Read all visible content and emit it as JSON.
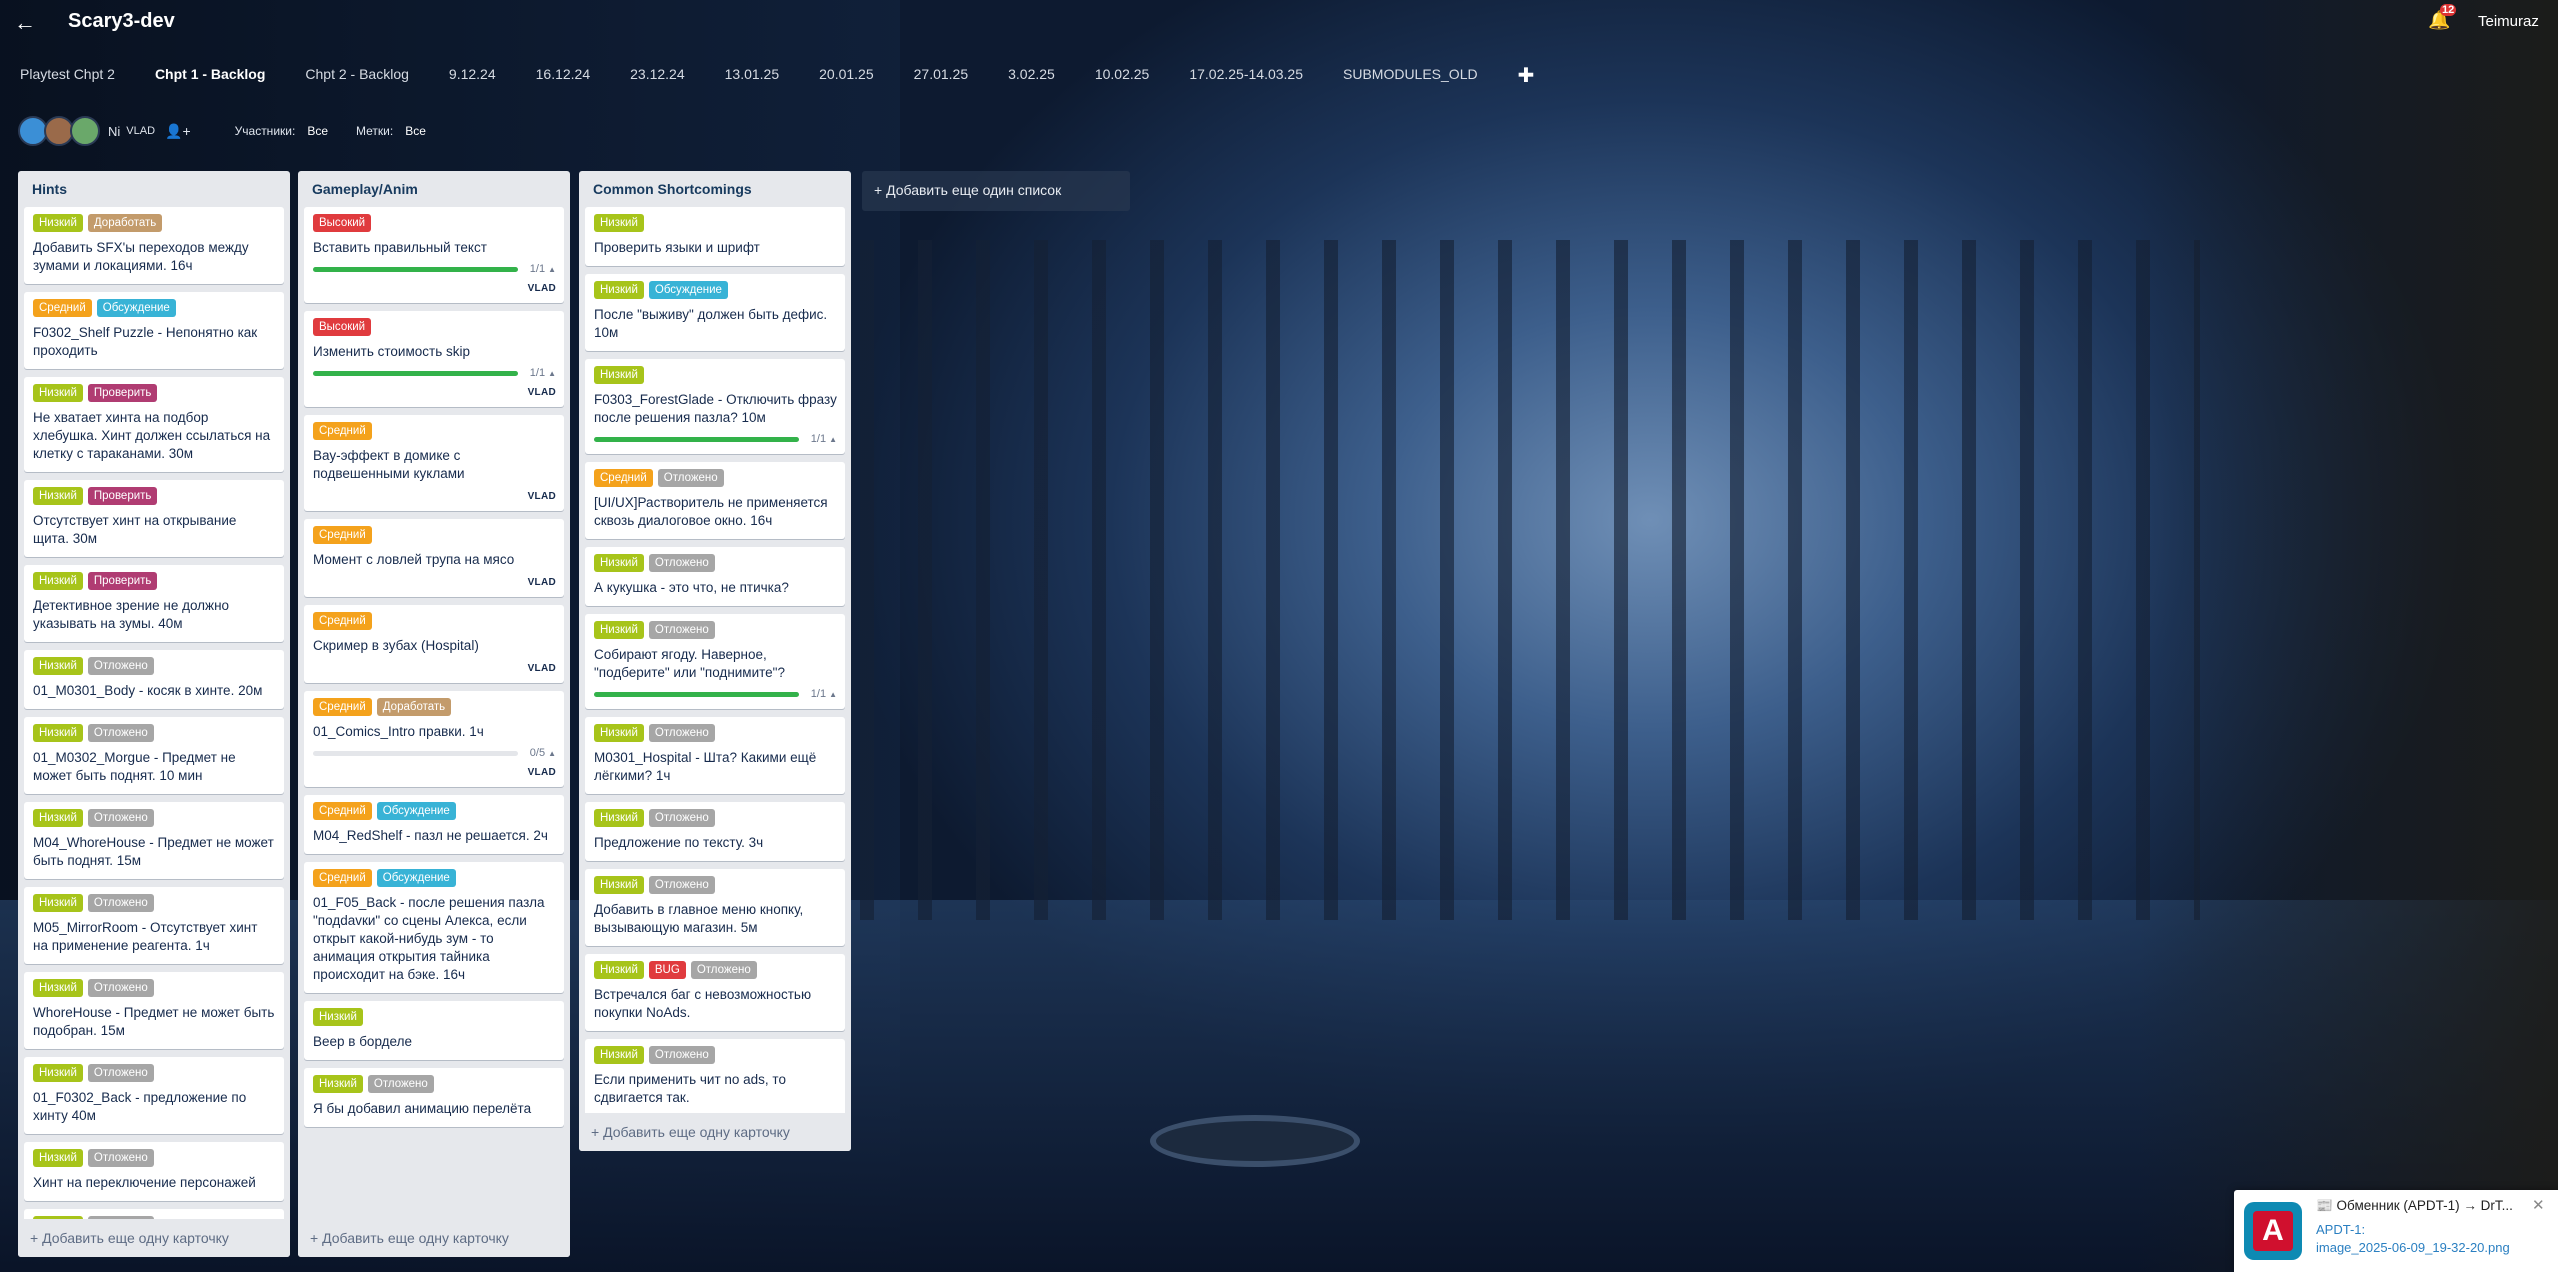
{
  "header": {
    "back_icon": "←",
    "title": "Scary3-dev",
    "bell_icon": "🔔",
    "notification_count": "12",
    "username": "Teimuraz"
  },
  "tabs": [
    {
      "label": "Playtest Chpt 2",
      "active": false
    },
    {
      "label": "Chpt 1 - Backlog",
      "active": true
    },
    {
      "label": "Chpt 2 - Backlog",
      "active": false
    },
    {
      "label": "9.12.24",
      "active": false
    },
    {
      "label": "16.12.24",
      "active": false
    },
    {
      "label": "23.12.24",
      "active": false
    },
    {
      "label": "13.01.25",
      "active": false
    },
    {
      "label": "20.01.25",
      "active": false
    },
    {
      "label": "27.01.25",
      "active": false
    },
    {
      "label": "3.02.25",
      "active": false
    },
    {
      "label": "10.02.25",
      "active": false
    },
    {
      "label": "17.02.25-14.03.25",
      "active": false
    },
    {
      "label": "SUBMODULES_OLD",
      "active": false
    }
  ],
  "tab_add": "✚",
  "members": {
    "avatar_colors": [
      "#3b8fd6",
      "#9a6a4a",
      "#6aa86a"
    ],
    "initials": "Ni",
    "vlad": "VLAD",
    "add_icon": "👤+",
    "participants_label": "Участники:",
    "participants_value": "Все",
    "tags_label": "Метки:",
    "tags_value": "Все"
  },
  "label_colors": {
    "low": "#a7c41a",
    "mid": "#f4a21c",
    "high": "#e03b3e",
    "rework": "#c39b6b",
    "discuss": "#38b3d6",
    "check": "#b03c72",
    "postponed": "#a6a6a6",
    "bug": "#e03b3e"
  },
  "lists": [
    {
      "title": "Hints",
      "footer": "+ Добавить еще одну карточку",
      "cards": [
        {
          "labels": [
            [
              "Низкий",
              "low"
            ],
            [
              "Доработать",
              "rework"
            ]
          ],
          "text": "Добавить SFX'ы переходов между зумами и локациями. 16ч"
        },
        {
          "labels": [
            [
              "Средний",
              "mid"
            ],
            [
              "Обсуждение",
              "discuss"
            ]
          ],
          "text": "F0302_Shelf Puzzle - Непонятно как проходить"
        },
        {
          "labels": [
            [
              "Низкий",
              "low"
            ],
            [
              "Проверить",
              "check"
            ]
          ],
          "text": "Не хватает хинта на подбор хлебушка. Хинт должен ссылаться на клетку с тараканами. 30м"
        },
        {
          "labels": [
            [
              "Низкий",
              "low"
            ],
            [
              "Проверить",
              "check"
            ]
          ],
          "text": "Отсутствует хинт на открывание щита. 30м"
        },
        {
          "labels": [
            [
              "Низкий",
              "low"
            ],
            [
              "Проверить",
              "check"
            ]
          ],
          "text": "Детективное зрение не должно указывать на зумы. 40м"
        },
        {
          "labels": [
            [
              "Низкий",
              "low"
            ],
            [
              "Отложено",
              "postponed"
            ]
          ],
          "text": "01_M0301_Body - косяк в хинте. 20м"
        },
        {
          "labels": [
            [
              "Низкий",
              "low"
            ],
            [
              "Отложено",
              "postponed"
            ]
          ],
          "text": "01_M0302_Morgue - Предмет не может быть поднят. 10 мин"
        },
        {
          "labels": [
            [
              "Низкий",
              "low"
            ],
            [
              "Отложено",
              "postponed"
            ]
          ],
          "text": "M04_WhoreHouse - Предмет не может быть поднят. 15м"
        },
        {
          "labels": [
            [
              "Низкий",
              "low"
            ],
            [
              "Отложено",
              "postponed"
            ]
          ],
          "text": "M05_MirrorRoom - Отсутствует хинт на применение реагента. 1ч"
        },
        {
          "labels": [
            [
              "Низкий",
              "low"
            ],
            [
              "Отложено",
              "postponed"
            ]
          ],
          "text": "WhoreHouse - Предмет не может быть подобран. 15м"
        },
        {
          "labels": [
            [
              "Низкий",
              "low"
            ],
            [
              "Отложено",
              "postponed"
            ]
          ],
          "text": "01_F0302_Back - предложение по хинту 40м"
        },
        {
          "labels": [
            [
              "Низкий",
              "low"
            ],
            [
              "Отложено",
              "postponed"
            ]
          ],
          "text": "Хинт на переключение персонажей"
        },
        {
          "labels": [
            [
              "Низкий",
              "low"
            ],
            [
              "Отложено",
              "postponed"
            ]
          ],
          "text": ""
        }
      ]
    },
    {
      "title": "Gameplay/Anim",
      "footer": "+ Добавить еще одну карточку",
      "cards": [
        {
          "labels": [
            [
              "Высокий",
              "high"
            ]
          ],
          "text": "Вставить правильный текст",
          "progress": {
            "text": "1/1",
            "fraction": 1
          },
          "member": "VLAD"
        },
        {
          "labels": [
            [
              "Высокий",
              "high"
            ]
          ],
          "text": "Изменить стоимость skip",
          "progress": {
            "text": "1/1",
            "fraction": 1
          },
          "member": "VLAD"
        },
        {
          "labels": [
            [
              "Средний",
              "mid"
            ]
          ],
          "text": "Вау-эффект в домике с подвешенными куклами",
          "member": "VLAD"
        },
        {
          "labels": [
            [
              "Средний",
              "mid"
            ]
          ],
          "text": "Момент с ловлей трупа на мясо",
          "member": "VLAD"
        },
        {
          "labels": [
            [
              "Средний",
              "mid"
            ]
          ],
          "text": "Скример в зубах (Hospital)",
          "member": "VLAD"
        },
        {
          "labels": [
            [
              "Средний",
              "mid"
            ],
            [
              "Доработать",
              "rework"
            ]
          ],
          "text": "01_Comics_Intro правки. 1ч",
          "progress": {
            "text": "0/5",
            "fraction": 0
          },
          "member": "VLAD"
        },
        {
          "labels": [
            [
              "Средний",
              "mid"
            ],
            [
              "Обсуждение",
              "discuss"
            ]
          ],
          "text": "M04_RedShelf - пазл не решается. 2ч"
        },
        {
          "labels": [
            [
              "Средний",
              "mid"
            ],
            [
              "Обсуждение",
              "discuss"
            ]
          ],
          "text": "01_F05_Back - после решения пазла \"подdavки\" со сцены Алекса, если открыт какой-нибудь зум - то анимация открытия тайника происходит на бэке. 16ч"
        },
        {
          "labels": [
            [
              "Низкий",
              "low"
            ]
          ],
          "text": "Веер в борделе"
        },
        {
          "labels": [
            [
              "Низкий",
              "low"
            ],
            [
              "Отложено",
              "postponed"
            ]
          ],
          "text": "Я бы добавил анимацию перелёта"
        }
      ]
    },
    {
      "title": "Common Shortcomings",
      "footer": "+ Добавить еще одну карточку",
      "cards": [
        {
          "labels": [
            [
              "Низкий",
              "low"
            ]
          ],
          "text": "Проверить языки и шрифт"
        },
        {
          "labels": [
            [
              "Низкий",
              "low"
            ],
            [
              "Обсуждение",
              "discuss"
            ]
          ],
          "text": "После \"выживу\" должен быть дефис. 10м"
        },
        {
          "labels": [
            [
              "Низкий",
              "low"
            ]
          ],
          "text": "F0303_ForestGlade - Отключить фразу после решения пазла? 10м",
          "progress": {
            "text": "1/1",
            "fraction": 1
          }
        },
        {
          "labels": [
            [
              "Средний",
              "mid"
            ],
            [
              "Отложено",
              "postponed"
            ]
          ],
          "text": "[UI/UX]Растворитель не применяется сквозь диалоговое окно. 16ч"
        },
        {
          "labels": [
            [
              "Низкий",
              "low"
            ],
            [
              "Отложено",
              "postponed"
            ]
          ],
          "text": "А кукушка - это что, не птичка?"
        },
        {
          "labels": [
            [
              "Низкий",
              "low"
            ],
            [
              "Отложено",
              "postponed"
            ]
          ],
          "text": "Собирают ягоду. Наверное, \"подберите\" или \"поднимите\"?",
          "progress": {
            "text": "1/1",
            "fraction": 1
          }
        },
        {
          "labels": [
            [
              "Низкий",
              "low"
            ],
            [
              "Отложено",
              "postponed"
            ]
          ],
          "text": "M0301_Hospital - Шта? Какими ещё лёгкими? 1ч"
        },
        {
          "labels": [
            [
              "Низкий",
              "low"
            ],
            [
              "Отложено",
              "postponed"
            ]
          ],
          "text": "Предложение по тексту. 3ч"
        },
        {
          "labels": [
            [
              "Низкий",
              "low"
            ],
            [
              "Отложено",
              "postponed"
            ]
          ],
          "text": "Добавить в главное меню кнопку, вызывающую магазин. 5м"
        },
        {
          "labels": [
            [
              "Низкий",
              "low"
            ],
            [
              "BUG",
              "bug"
            ],
            [
              "Отложено",
              "postponed"
            ]
          ],
          "text": "Встречался баг с невозможностью покупки NoAds."
        },
        {
          "labels": [
            [
              "Низкий",
              "low"
            ],
            [
              "Отложено",
              "postponed"
            ]
          ],
          "text": "Если применить чит no ads, то сдвигается так."
        }
      ]
    }
  ],
  "add_list": "+ Добавить еще один список",
  "toast": {
    "icon_letter": "A",
    "title": "📰 Обменник (APDT-1) → DrT...",
    "close_icon": "✕",
    "line1": "APDT-1:",
    "line2": "image_2025-06-09_19-32-20.png"
  }
}
